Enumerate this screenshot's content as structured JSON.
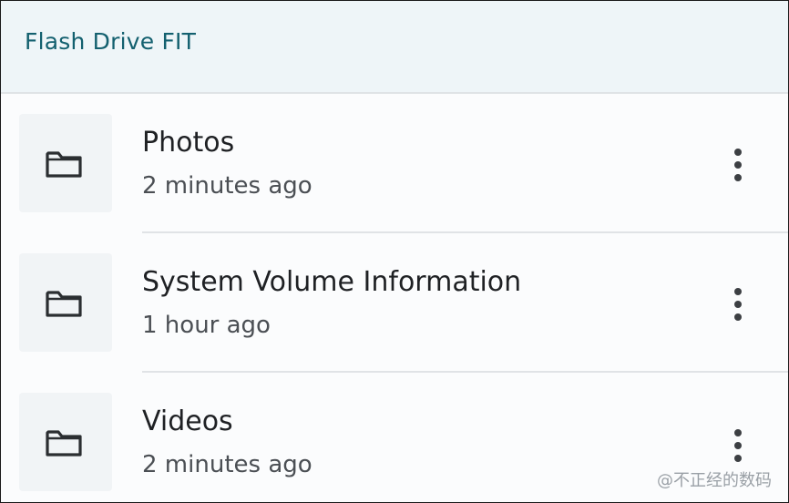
{
  "header": {
    "title": "Flash Drive FIT"
  },
  "items": [
    {
      "name": "Photos",
      "modified": "2 minutes ago",
      "icon": "folder-icon",
      "more_icon": "more-vert-icon"
    },
    {
      "name": "System Volume Information",
      "modified": "1 hour ago",
      "icon": "folder-icon",
      "more_icon": "more-vert-icon"
    },
    {
      "name": "Videos",
      "modified": "2 minutes ago",
      "icon": "folder-icon",
      "more_icon": "more-vert-icon"
    }
  ],
  "watermark": "@不正经的数码",
  "colors": {
    "header_bg": "#eef5f8",
    "header_text": "#13606f",
    "primary_text": "#1f2124",
    "secondary_text": "#4b4f54"
  }
}
